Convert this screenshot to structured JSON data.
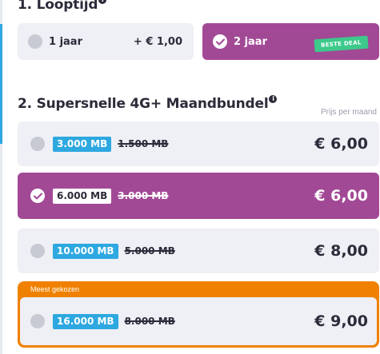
{
  "section1": {
    "title": "1. Looptijd",
    "info_icon": "i",
    "options": [
      {
        "label": "1 jaar",
        "extra": "+ € 1,00",
        "selected": false
      },
      {
        "label": "2 jaar",
        "badge": "BESTE DEAL",
        "selected": true
      }
    ]
  },
  "section2": {
    "title": "2. Supersnelle 4G+ Maandbundel",
    "info_icon": "i",
    "price_note": "Prijs per maand",
    "bundles": [
      {
        "mb": "3.000 MB",
        "old_mb": "1.500 MB",
        "price": "€ 6,00",
        "selected": false
      },
      {
        "mb": "6.000 MB",
        "old_mb": "3.000 MB",
        "price": "€ 6,00",
        "selected": true
      },
      {
        "mb": "10.000 MB",
        "old_mb": "5.000 MB",
        "price": "€ 8,00",
        "selected": false
      },
      {
        "mb": "16.000 MB",
        "old_mb": "8.000 MB",
        "price": "€ 9,00",
        "selected": false,
        "popular_label": "Meest gekozen"
      }
    ]
  },
  "colors": {
    "accent_purple": "#a24996",
    "mb_blue": "#2ea8e0",
    "popular_orange": "#f08100",
    "deal_green": "#3cc98a",
    "card_bg": "#eef0f5"
  }
}
